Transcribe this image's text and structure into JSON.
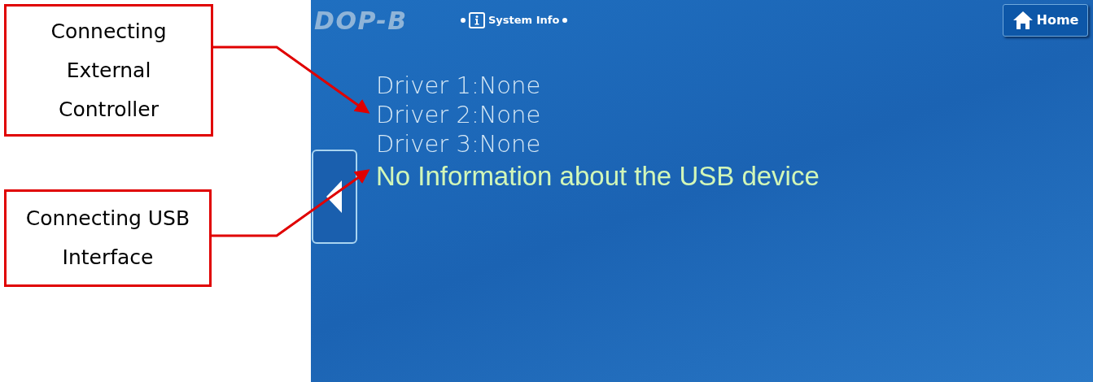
{
  "annotations": [
    {
      "text": "Connecting External Controller"
    },
    {
      "text": "Connecting USB Interface"
    }
  ],
  "screen": {
    "logo": "DOP-B",
    "title": "System Info",
    "home_button": "Home",
    "lines": [
      "Driver 1:None",
      "Driver 2:None",
      "Driver 3:None"
    ],
    "usb_message": "No Information about the USB device"
  }
}
